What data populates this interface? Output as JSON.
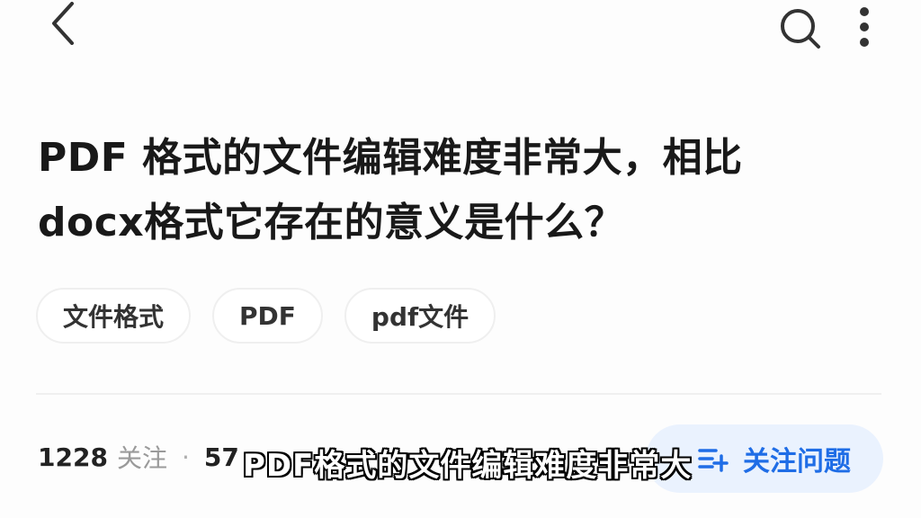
{
  "topbar": {
    "back_icon": "chevron-left-icon",
    "search_icon": "search-icon",
    "more_icon": "more-vertical-icon"
  },
  "question": {
    "title_line1": "PDF 格式的文件编辑难度非常大，相比",
    "title_line2": "docx格式它存在的意义是什么？"
  },
  "tags": [
    {
      "label": "文件格式"
    },
    {
      "label": "PDF"
    },
    {
      "label": "pdf文件"
    }
  ],
  "stats": {
    "followers_count": "1228",
    "followers_label": "关注",
    "separator": "·",
    "second_count": "57"
  },
  "follow_button": {
    "label": "关注问题",
    "icon": "follow-list-add-icon",
    "accent": "#1f6de6",
    "background": "#eaf2fe"
  },
  "subtitle": {
    "text": "PDF格式的文件编辑难度非常大"
  }
}
